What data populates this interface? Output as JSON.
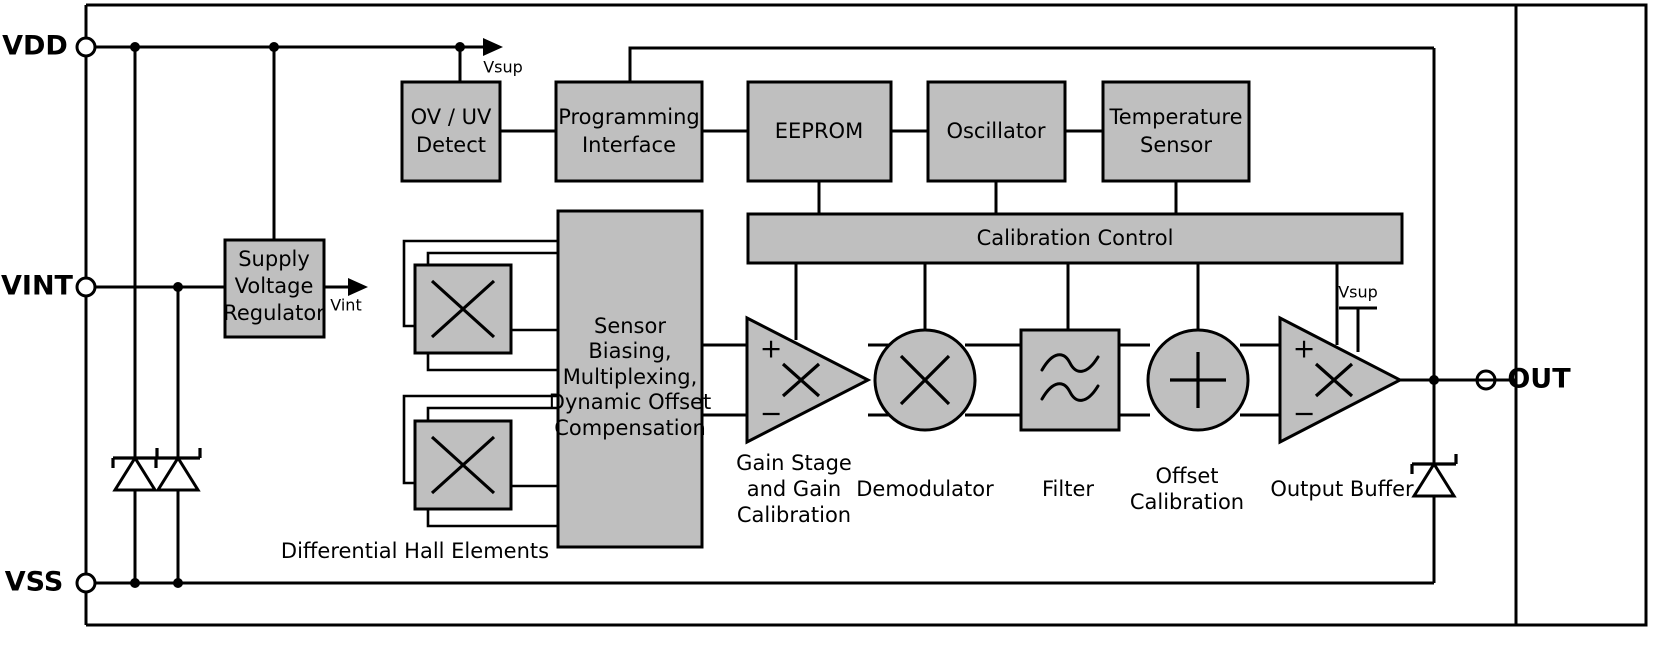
{
  "diagram": {
    "title": "Hall Effect Sensor IC Block Diagram",
    "fill_color": "#bfbfbf",
    "line_color": "#000000",
    "background": "#ffffff"
  },
  "pins": {
    "vdd": "VDD",
    "vint": "VINT",
    "vss": "VSS",
    "out": "OUT"
  },
  "nets": {
    "vsup": "Vsup",
    "vint_out": "Vint",
    "vsup_buffer": "Vsup"
  },
  "blocks": {
    "ov_uv_detect": {
      "line1": "OV / UV",
      "line2": "Detect"
    },
    "programming_interface": {
      "line1": "Programming",
      "line2": "Interface"
    },
    "eeprom": {
      "line1": "EEPROM"
    },
    "oscillator": {
      "line1": "Oscillator"
    },
    "temperature_sensor": {
      "line1": "Temperature",
      "line2": "Sensor"
    },
    "calibration_control": {
      "line1": "Calibration Control"
    },
    "supply_voltage_regulator": {
      "line1": "Supply",
      "line2": "Voltage",
      "line3": "Regulator"
    },
    "sensor_biasing": {
      "line1": "Sensor",
      "line2": "Biasing,",
      "line3": "Multiplexing,",
      "line4": "Dynamic Offset",
      "line5": "Compensation"
    },
    "filter": {
      "icon": "approx-wave-icon"
    },
    "hall_element_top": {
      "icon": "cross-icon"
    },
    "hall_element_bottom": {
      "icon": "cross-icon"
    },
    "demodulator": {
      "icon": "multiply-circle-icon"
    },
    "offset_adder": {
      "icon": "plus-circle-icon"
    },
    "gain_stage": {
      "plus": "+",
      "minus": "−",
      "icon": "multiply-icon"
    },
    "output_buffer": {
      "plus": "+",
      "minus": "−",
      "icon": "multiply-icon"
    }
  },
  "captions": {
    "hall_elements": "Differential Hall Elements",
    "gain_stage": {
      "line1": "Gain Stage",
      "line2": "and Gain",
      "line3": "Calibration"
    },
    "demodulator": "Demodulator",
    "filter": "Filter",
    "offset_calibration": {
      "line1": "Offset",
      "line2": "Calibration"
    },
    "output_buffer": "Output Buffer"
  },
  "symbols": {
    "zener_vdd": "zener-diode-icon",
    "zener_vint": "zener-diode-icon",
    "zener_out": "zener-diode-icon"
  }
}
